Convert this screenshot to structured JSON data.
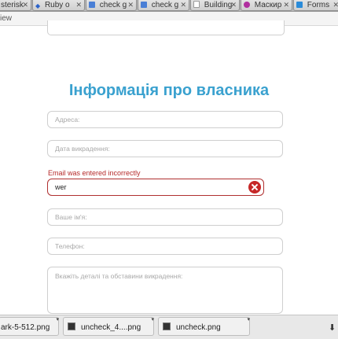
{
  "tabs": [
    {
      "label": "sterisk",
      "icon": "document-icon"
    },
    {
      "label": "Ruby o",
      "icon": "ruby-icon"
    },
    {
      "label": "check g",
      "icon": "google-icon"
    },
    {
      "label": "check g",
      "icon": "google-icon"
    },
    {
      "label": "Building",
      "icon": "document-icon"
    },
    {
      "label": "Маскир",
      "icon": "flow-icon"
    },
    {
      "label": "Forms",
      "icon": "forms-icon"
    }
  ],
  "address": {
    "text": "iew"
  },
  "form": {
    "title": "Інформація про власника",
    "address_placeholder": "Адреса:",
    "theft_date_placeholder": "Дата викрадення:",
    "email_error": "Email was entered incorrectly",
    "email_value": "wer",
    "name_placeholder": "Ваше ім'я:",
    "phone_placeholder": "Телефон:",
    "details_placeholder": "Вкажіть деталі та обставини викрадення:"
  },
  "downloads": [
    {
      "name": "ark-5-512.png"
    },
    {
      "name": "uncheck_4....png"
    },
    {
      "name": "uncheck.png"
    }
  ],
  "colors": {
    "accent": "#3aa1cf",
    "error": "#c62828"
  }
}
